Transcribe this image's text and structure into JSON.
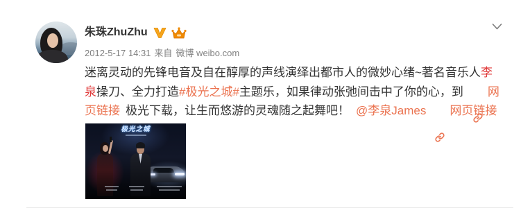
{
  "post": {
    "author": "朱珠ZhuZhu",
    "meta": {
      "time": "2012-5-17 14:31",
      "from_label": "来自",
      "source": "微博 weibo.com"
    },
    "body": {
      "line1": {
        "text": "迷离灵动的先锋电音及自在醇厚的声线演绎出都市人的微妙心绪~著名音乐人",
        "keyword": "李"
      },
      "line2": {
        "keyword": "泉",
        "text_a": "操刀、全力打造",
        "topic": "#极光之城#",
        "text_b": "主题乐，如果律动张弛间击中了你的心，到",
        "link_part": "网"
      },
      "line3": {
        "link_part": "页链接",
        "text": "极光下载，让生而悠游的灵魂随之起舞吧！",
        "mention": "@李泉James",
        "link": "网页链接"
      }
    },
    "image": {
      "poster_title": "极光之城"
    }
  },
  "icons": {
    "verified": "verified-v-icon",
    "member": "member-crown-icon",
    "menu": "chevron-down-icon",
    "link": "link-icon"
  },
  "colors": {
    "text": "#333333",
    "meta": "#808080",
    "link": "#eb7350",
    "highlight": "#e03c3c",
    "verified": "#f7a51c",
    "member": "#f08a00",
    "divider": "#e8e8e8"
  }
}
